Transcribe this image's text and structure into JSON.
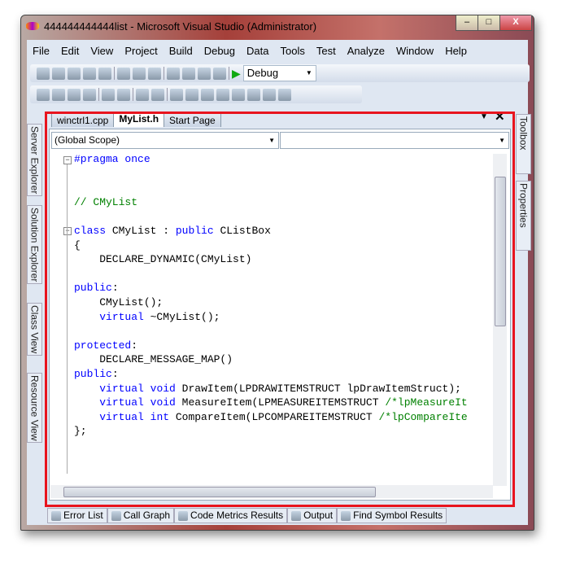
{
  "window": {
    "title": "444444444444list - Microsoft Visual Studio (Administrator)",
    "minimize": "–",
    "maximize": "□",
    "close": "X"
  },
  "menu": [
    "File",
    "Edit",
    "View",
    "Project",
    "Build",
    "Debug",
    "Data",
    "Tools",
    "Test",
    "Analyze",
    "Window",
    "Help"
  ],
  "toolbar": {
    "config": "Debug"
  },
  "left_panels": [
    "Server Explorer",
    "Solution Explorer",
    "Class View",
    "Resource View"
  ],
  "right_panels": [
    "Toolbox",
    "Properties"
  ],
  "tabs": [
    {
      "label": "winctrl1.cpp"
    },
    {
      "label": "MyList.h",
      "active": true
    },
    {
      "label": "Start Page"
    }
  ],
  "scope": {
    "left": "(Global Scope)",
    "right": ""
  },
  "code": [
    [
      [
        "#pragma once",
        "kw"
      ]
    ],
    [],
    [],
    [
      [
        "// CMyList",
        "cm"
      ]
    ],
    [],
    [
      [
        "class",
        "kw"
      ],
      [
        " CMyList : ",
        "tx"
      ],
      [
        "public",
        "kw"
      ],
      [
        " CListBox",
        "tx"
      ]
    ],
    [
      [
        "{",
        "tx"
      ]
    ],
    [
      [
        "    DECLARE_DYNAMIC(CMyList)",
        "tx"
      ]
    ],
    [],
    [
      [
        "public",
        "kw"
      ],
      [
        ":",
        "tx"
      ]
    ],
    [
      [
        "    CMyList();",
        "tx"
      ]
    ],
    [
      [
        "    ",
        "tx"
      ],
      [
        "virtual",
        "kw"
      ],
      [
        " ~CMyList();",
        "tx"
      ]
    ],
    [],
    [
      [
        "protected",
        "kw"
      ],
      [
        ":",
        "tx"
      ]
    ],
    [
      [
        "    DECLARE_MESSAGE_MAP()",
        "tx"
      ]
    ],
    [
      [
        "public",
        "kw"
      ],
      [
        ":",
        "tx"
      ]
    ],
    [
      [
        "    ",
        "tx"
      ],
      [
        "virtual",
        "kw"
      ],
      [
        " ",
        "tx"
      ],
      [
        "void",
        "kw"
      ],
      [
        " DrawItem(LPDRAWITEMSTRUCT lpDrawItemStruct);",
        "tx"
      ]
    ],
    [
      [
        "    ",
        "tx"
      ],
      [
        "virtual",
        "kw"
      ],
      [
        " ",
        "tx"
      ],
      [
        "void",
        "kw"
      ],
      [
        " MeasureItem(LPMEASUREITEMSTRUCT ",
        "tx"
      ],
      [
        "/*lpMeasureIt",
        "cm"
      ]
    ],
    [
      [
        "    ",
        "tx"
      ],
      [
        "virtual",
        "kw"
      ],
      [
        " ",
        "tx"
      ],
      [
        "int",
        "kw"
      ],
      [
        " CompareItem(LPCOMPAREITEMSTRUCT ",
        "tx"
      ],
      [
        "/*lpCompareIte",
        "cm"
      ]
    ],
    [
      [
        "};",
        "tx"
      ]
    ]
  ],
  "bottom_tabs": [
    "Error List",
    "Call Graph",
    "Code Metrics Results",
    "Output",
    "Find Symbol Results"
  ],
  "colors": {
    "highlight": "#e8141e",
    "keyword": "#0000ff",
    "comment": "#008000"
  }
}
